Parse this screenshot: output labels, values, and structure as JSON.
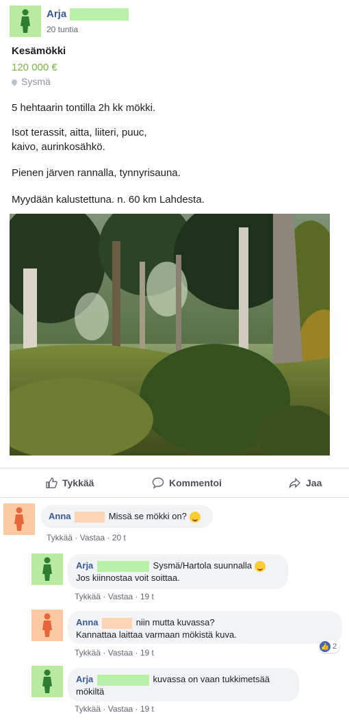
{
  "post": {
    "author": "Arja",
    "time": "20 tuntia",
    "title": "Kesämökki",
    "price": "120 000 €",
    "location": "Sysmä",
    "paragraphs": [
      "5 hehtaarin tontilla 2h kk mökki.",
      "Isot terassit, aitta, liiteri, puuc,\nkaivo, aurinkosähkö.",
      "Pienen järven rannalla, tynnyrisauna.",
      "Myydään kalustettuna. n. 60 km Lahdesta."
    ]
  },
  "actions": {
    "like": "Tykkää",
    "comment": "Kommentoi",
    "share": "Jaa"
  },
  "comments": [
    {
      "author": "Anna",
      "text": "Missä se mökki on?",
      "like": "Tykkää",
      "reply": "Vastaa",
      "time": "20 t"
    },
    {
      "author": "Arja",
      "text_line1": "Sysmä/Hartola suunnalla",
      "text_line2": "Jos kiinnostaa voit soittaa.",
      "like": "Tykkää",
      "reply": "Vastaa",
      "time": "19 t"
    },
    {
      "author": "Anna",
      "text_line1": "niin mutta kuvassa?",
      "text_line2": "Kannattaa laittaa varmaan mökistä kuva.",
      "like": "Tykkää",
      "reply": "Vastaa",
      "time": "19 t",
      "reactions": "2"
    },
    {
      "author": "Arja",
      "text_line1": "kuvassa on vaan tukkimetsää",
      "text_line2": "mökiltä",
      "like": "Tykkää",
      "reply": "Vastaa",
      "time": "19 t"
    }
  ],
  "separator": "·",
  "icons": {
    "avatar_female": "person-silhouette-icon",
    "like": "thumbs-up-icon",
    "comment": "speech-bubble-icon",
    "share": "share-arrow-icon",
    "location": "map-pin-icon",
    "emoji": "smile-emoji-icon",
    "reaction": "like-reaction-icon"
  },
  "colors": {
    "name_link": "#385898",
    "price": "#7cb342",
    "avatar_green": "#b9eaa0",
    "avatar_peach": "#fcc9a3",
    "bubble": "#f2f3f5"
  }
}
